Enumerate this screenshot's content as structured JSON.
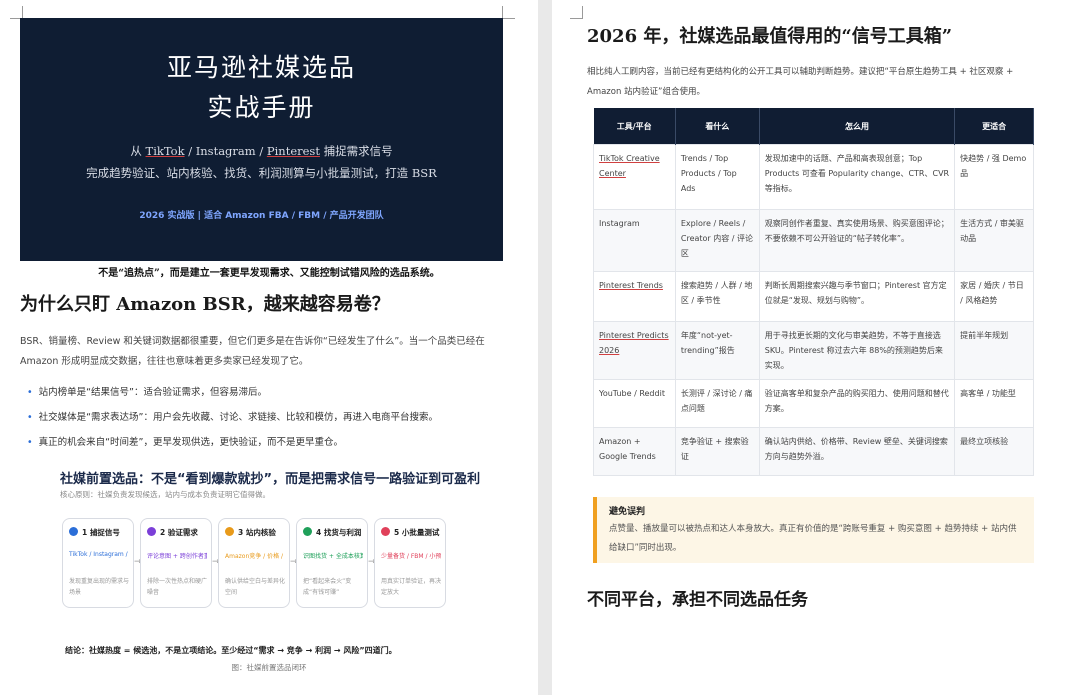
{
  "left": {
    "cover": {
      "title_line1": "亚马逊社媒选品",
      "title_line2": "实战手册",
      "sub1_prefix": "从 ",
      "sub1_tiktok": "TikTok",
      "sub1_mid": " / Instagram / ",
      "sub1_pinterest": "Pinterest",
      "sub1_suffix": " 捕捉需求信号",
      "sub2": "完成趋势验证、站内核验、找货、利润测算与小批量测试，打造 BSR",
      "tagline": "2026 实战版 | 适合 Amazon FBA / FBM / 产品开发团队"
    },
    "caption": "不是“追热点”，而是建立一套更早发现需求、又能控制试错风险的选品系统。",
    "section1": {
      "heading": "为什么只盯 Amazon BSR，越来越容易卷？",
      "para_line1": "BSR、销量榜、Review 和关键词数据都很重要，但它们更多是在告诉你“已经发生了什么”。当一个品类已经在",
      "para_line2": "Amazon 形成明显成交数据，往往也意味着更多卖家已经发现了它。",
      "bullets": [
        "站内榜单是“结果信号”：适合验证需求，但容易滞后。",
        "社交媒体是“需求表达场”：用户会先收藏、讨论、求链接、比较和模仿，再进入电商平台搜索。",
        "真正的机会来自“时间差”，更早发现供选，更快验证，而不是更早重仓。"
      ]
    },
    "flow": {
      "title": "社媒前置选品：不是“看到爆款就抄”，而是把需求信号一路验证到可盈利",
      "subtitle": "核心原则：社媒负责发现候选，站内与成本负责证明它值得做。",
      "steps": [
        {
          "title": "1 捕捉信号",
          "sub": "TikTok / Instagram / Pinterest",
          "desc": "发现重复出现的需求与场景",
          "color": "#2b6ed8"
        },
        {
          "title": "2 验证需求",
          "sub": "评论意图 + 跨创作者重复",
          "desc": "排除一次性热点和硬广噪音",
          "color": "#7b3fd8"
        },
        {
          "title": "3 站内核验",
          "sub": "Amazon竞争 / 价格 / 评论",
          "desc": "确认供给空白与差异化空间",
          "color": "#e89a1a"
        },
        {
          "title": "4 找货与利润",
          "sub": "识图找货 + 全成本核算",
          "desc": "把“看起来会火”变成“有钱可赚”",
          "color": "#1fa05a"
        },
        {
          "title": "5 小批量测试",
          "sub": "少量备货 / FBM / 小预算",
          "desc": "用真实订单验证，再决定放大",
          "color": "#e0405a"
        }
      ],
      "conclusion": "结论：社媒热度 = 候选池，不是立项结论。至少经过“需求 → 竞争 → 利润 → 风险”四道门。",
      "figure_caption": "图：社媒前置选品闭环"
    }
  },
  "right": {
    "heading": "2026 年，社媒选品最值得用的“信号工具箱”",
    "intro_line1": "相比纯人工刷内容，当前已经有更结构化的公开工具可以辅助判断趋势。建议把“平台原生趋势工具 + 社区观察 +",
    "intro_line2": "Amazon 站内验证”组合使用。",
    "table": {
      "headers": [
        "工具/平台",
        "看什么",
        "怎么用",
        "更适合"
      ],
      "rows": [
        {
          "tool": "TikTok Creative Center",
          "what": "Trends / Top Products / Top Ads",
          "how": "发现加速中的话题、产品和高表现创意；Top Products 可查看 Popularity change、CTR、CVR 等指标。",
          "fit": "快趋势 / 强 Demo 品"
        },
        {
          "tool": "Instagram",
          "what": "Explore / Reels / Creator 内容 / 评论区",
          "how": "观察同创作者重复、真实使用场景、购买意图评论；不要依赖不可公开验证的“帖子转化率”。",
          "fit": "生活方式 / 审美驱动品"
        },
        {
          "tool": "Pinterest Trends",
          "what": "搜索趋势 / 人群 / 地区 / 季节性",
          "how": "判断长周期搜索兴趣与季节窗口；Pinterest 官方定位就是“发现、规划与购物”。",
          "fit": "家居 / 婚庆 / 节日 / 风格趋势"
        },
        {
          "tool": "Pinterest Predicts 2026",
          "what": "年度“not-yet-trending”报告",
          "how": "用于寻找更长期的文化与审美趋势，不等于直接选 SKU。Pinterest 称过去六年 88%的预测趋势后来实现。",
          "fit": "提前半年规划"
        },
        {
          "tool": "YouTube / Reddit",
          "what": "长测评 / 深讨论 / 痛点问题",
          "how": "验证高客单和复杂产品的购买阻力、使用问题和替代方案。",
          "fit": "高客单 / 功能型"
        },
        {
          "tool": "Amazon + Google Trends",
          "what": "竞争验证 + 搜索验证",
          "how": "确认站内供给、价格带、Review 壁垒、关键词搜索方向与趋势外溢。",
          "fit": "最终立项核验"
        }
      ]
    },
    "warning": {
      "title": "避免误判",
      "body": "点赞量、播放量可以被热点和达人本身放大。真正有价值的是“跨账号重复 + 购买意图 + 趋势持续 + 站内供给缺口”同时出现。"
    },
    "heading2": "不同平台，承担不同选品任务"
  }
}
